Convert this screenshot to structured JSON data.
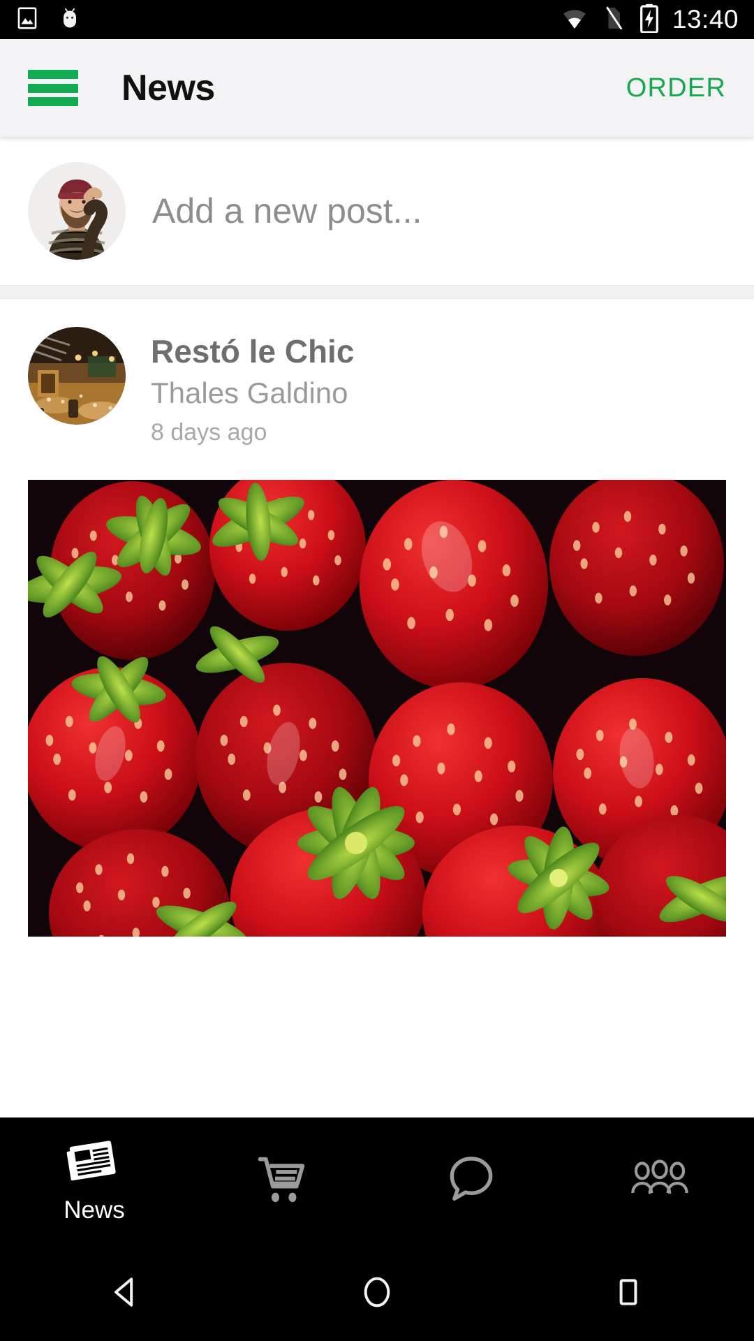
{
  "status_bar": {
    "time": "13:40",
    "icons": [
      "image-icon",
      "android-head-icon",
      "wifi-icon",
      "sim-missing-icon",
      "battery-charging-icon"
    ],
    "background": "#000000",
    "foreground": "#ffffff"
  },
  "app_bar": {
    "menu_icon": "hamburger-menu-icon",
    "title": "News",
    "action_label": "ORDER",
    "accent_color": "#16a84c",
    "background": "#f3f3f5"
  },
  "composer": {
    "avatar_alt": "user-avatar",
    "placeholder": "Add a new post..."
  },
  "post": {
    "avatar_alt": "restaurant-avatar",
    "title": "Restó le Chic",
    "author": "Thales Galdino",
    "time": "8 days ago",
    "image_alt": "strawberries-photo"
  },
  "bottom_nav": {
    "items": [
      {
        "icon": "newspaper-icon",
        "label": "News",
        "active": true
      },
      {
        "icon": "shopping-cart-icon",
        "label": "",
        "active": false
      },
      {
        "icon": "chat-bubble-icon",
        "label": "",
        "active": false
      },
      {
        "icon": "people-group-icon",
        "label": "",
        "active": false
      }
    ],
    "active_color": "#ffffff",
    "inactive_color": "#9b9b9b",
    "background": "#000000"
  },
  "system_nav": {
    "buttons": [
      "back-triangle-icon",
      "home-circle-icon",
      "recents-square-icon"
    ],
    "background": "#000000"
  }
}
